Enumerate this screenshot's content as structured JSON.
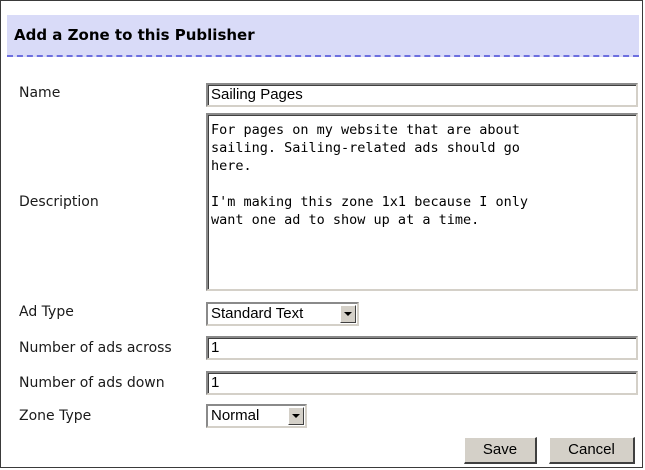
{
  "form": {
    "title": "Add a Zone to this Publisher",
    "fields": {
      "name": {
        "label": "Name",
        "value": "Sailing Pages"
      },
      "description": {
        "label": "Description",
        "value": "For pages on my website that are about\nsailing. Sailing-related ads should go\nhere.\n\nI'm making this zone 1x1 because I only\nwant one ad to show up at a time."
      },
      "ad_type": {
        "label": "Ad Type",
        "value": "Standard Text"
      },
      "ads_across": {
        "label": "Number of ads across",
        "value": "1"
      },
      "ads_down": {
        "label": "Number of ads down",
        "value": "1"
      },
      "zone_type": {
        "label": "Zone Type",
        "value": "Normal"
      }
    },
    "buttons": {
      "save": "Save",
      "cancel": "Cancel"
    }
  },
  "icons": {
    "dropdown": "chevron-down-icon"
  },
  "colors": {
    "title_bar_bg": "#d9dbf8",
    "title_bar_border": "#6d6fe0",
    "button_face": "#d4d0c8"
  }
}
